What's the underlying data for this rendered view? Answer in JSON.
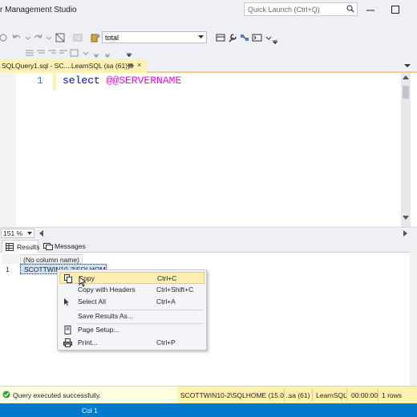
{
  "window": {
    "title": "r Management Studio",
    "quick_launch_placeholder": "Quick Launch (Ctrl+Q)"
  },
  "toolbar": {
    "database": "total"
  },
  "document_tab": {
    "label": "SQLQuery1.sql - SC....LearnSQL (sa (61))*",
    "close_glyph": "×"
  },
  "editor": {
    "line_number": "1",
    "code_keyword": "select",
    "code_function": "@@SERVERNAME"
  },
  "zoom": {
    "value": "151 %"
  },
  "results": {
    "tabs": [
      "Results",
      "Messages"
    ],
    "column_header": "(No column name)",
    "row_number": "1",
    "cell_value": "SCOTTWIN10-2\\SQLHOME"
  },
  "context_menu": {
    "items": [
      {
        "label": "Copy",
        "shortcut": "Ctrl+C",
        "icon": "copy-icon"
      },
      {
        "label": "Copy with Headers",
        "shortcut": "Ctrl+Shift+C",
        "icon": ""
      },
      {
        "label": "Select All",
        "shortcut": "Ctrl+A",
        "icon": "select-all-icon"
      },
      {
        "label": "Save Results As...",
        "shortcut": "",
        "icon": ""
      },
      {
        "label": "Page Setup...",
        "shortcut": "",
        "icon": "page-setup-icon"
      },
      {
        "label": "Print...",
        "shortcut": "Ctrl+P",
        "icon": "print-icon"
      }
    ]
  },
  "statusbar": {
    "message": "Query executed successfully.",
    "server": "SCOTTWIN10-2\\SQLHOME (15.0 ...",
    "user": "sa (61)",
    "database": "LearnSQL",
    "elapsed": "00:00:00",
    "rows": "1 rows"
  },
  "appbar": {
    "column": "Col 1"
  },
  "colors": {
    "accent_blue": "#007acc",
    "tab_highlight": "#fff1b2",
    "keyword": "#0000ff",
    "function": "#ff00ff"
  }
}
